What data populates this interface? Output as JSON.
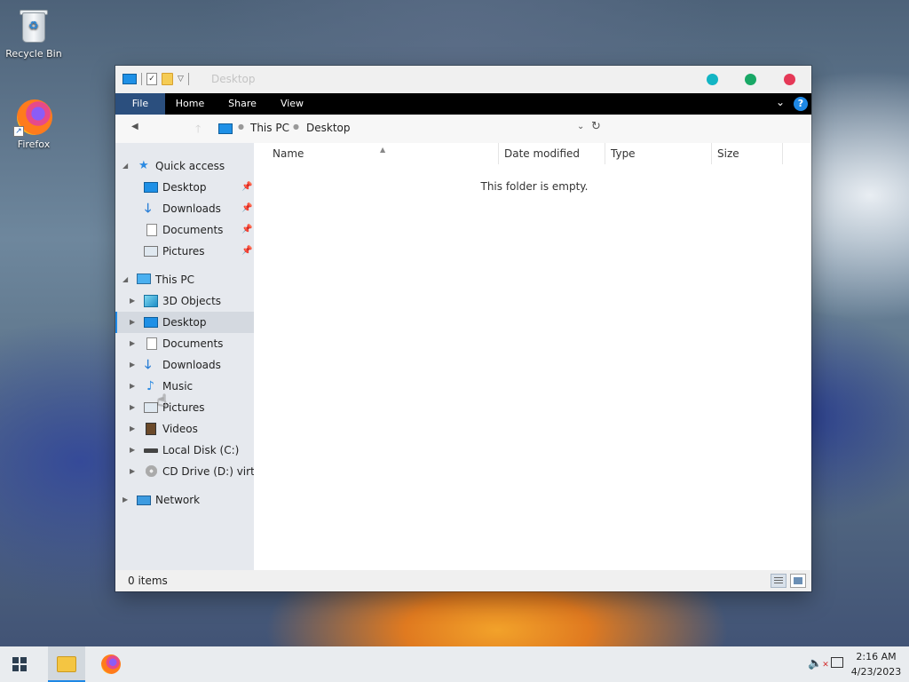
{
  "desktop": {
    "icons": [
      {
        "label": "Recycle Bin",
        "icon": "recycle-bin-icon"
      },
      {
        "label": "Firefox",
        "icon": "firefox-icon"
      }
    ]
  },
  "window": {
    "title": "Desktop",
    "ribbon_tabs": [
      "File",
      "Home",
      "Share",
      "View"
    ],
    "help_symbol": "?",
    "address": {
      "crumbs": [
        "This PC",
        "Desktop"
      ]
    },
    "nav": {
      "quick_access": "Quick access",
      "quick_items": [
        "Desktop",
        "Downloads",
        "Documents",
        "Pictures"
      ],
      "this_pc": "This PC",
      "pc_items": [
        "3D Objects",
        "Desktop",
        "Documents",
        "Downloads",
        "Music",
        "Pictures",
        "Videos",
        "Local Disk (C:)",
        "CD Drive (D:) virtio-"
      ],
      "network": "Network",
      "selected": "Desktop"
    },
    "columns": [
      "Name",
      "Date modified",
      "Type",
      "Size"
    ],
    "empty_message": "This folder is empty.",
    "status": "0 items"
  },
  "taskbar": {
    "time": "2:16 AM",
    "date": "4/23/2023"
  },
  "colors": {
    "accent": "#1e88e5",
    "ribbon_bg": "#000000",
    "file_tab": "#2b4f7e",
    "min_button": "#13b5c4",
    "max_button": "#19a866",
    "close_button": "#e53957"
  }
}
